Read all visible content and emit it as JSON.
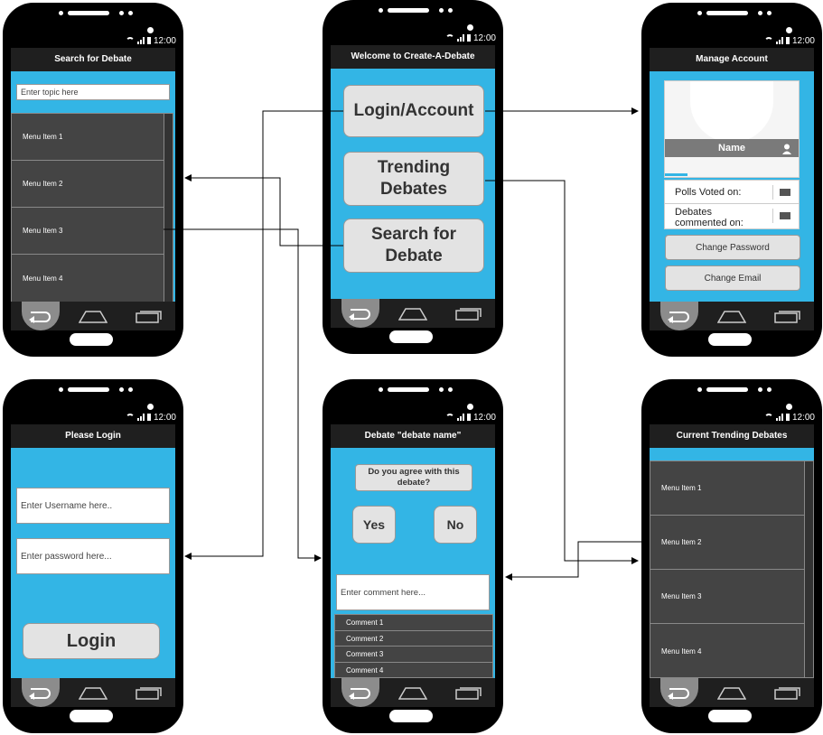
{
  "status": {
    "time": "12:00"
  },
  "welcome": {
    "title": "Welcome to Create-A-Debate",
    "login_btn": "Login/Account",
    "trending_btn_l1": "Trending",
    "trending_btn_l2": "Debates",
    "search_btn_l1": "Search for",
    "search_btn_l2": "Debate"
  },
  "search": {
    "title": "Search for Debate",
    "placeholder": "Enter topic here",
    "items": [
      "Menu Item 1",
      "Menu Item 2",
      "Menu Item 3",
      "Menu Item 4"
    ]
  },
  "account": {
    "title": "Manage Account",
    "name": "Name",
    "polls": "Polls Voted on:",
    "debates_l1": "Debates",
    "debates_l2": "commented on:",
    "change_password": "Change Password",
    "change_email": "Change Email"
  },
  "login": {
    "title": "Please Login",
    "username": "Enter Username here..",
    "password": "Enter password here...",
    "button": "Login"
  },
  "debate": {
    "title": "Debate \"debate name\"",
    "question_l1": "Do you agree with this",
    "question_l2": "debate?",
    "yes": "Yes",
    "no": "No",
    "comment_placeholder": "Enter comment here...",
    "comments": [
      "Comment  1",
      "Comment 2",
      "Comment 3",
      "Comment 4"
    ]
  },
  "trending": {
    "title": "Current Trending Debates",
    "items": [
      "Menu Item 1",
      "Menu Item 2",
      "Menu Item 3",
      "Menu Item 4"
    ]
  },
  "colors": {
    "screen": "#33b5e5",
    "frame": "#000000",
    "titlebar": "#1f1f1f",
    "list": "#444444"
  }
}
